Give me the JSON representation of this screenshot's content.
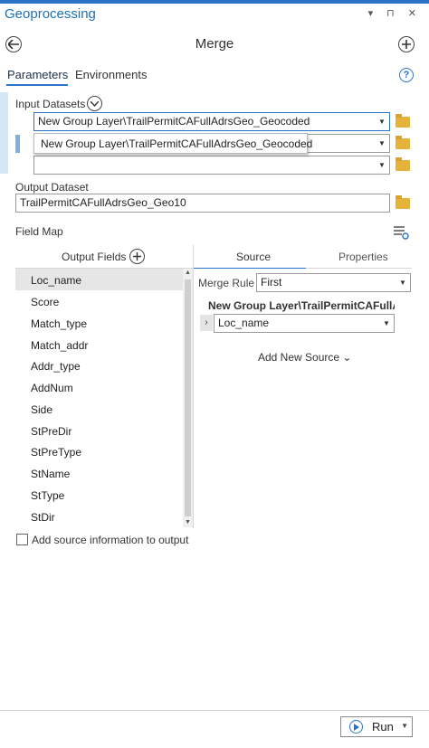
{
  "window": {
    "title": "Geoprocessing",
    "controls": "▾ ⊓ ✕"
  },
  "header": {
    "tool_name": "Merge",
    "back_icon": "circle-arrow-left-icon",
    "add_icon": "circle-plus-icon"
  },
  "tabs": [
    {
      "label": "Parameters",
      "active": true
    },
    {
      "label": "Environments",
      "active": false
    }
  ],
  "help": "?",
  "input_datasets": {
    "label": "Input Datasets",
    "rows": [
      "New Group Layer\\TrailPermitCAFullAdrsGeo_Geocoded",
      "",
      ""
    ],
    "popup_text": "New Group Layer\\TrailPermitCAFullAdrsGeo_Geocoded"
  },
  "output_dataset": {
    "label": "Output Dataset",
    "value": "TrailPermitCAFullAdrsGeo_Geo10"
  },
  "field_map": {
    "label": "Field Map",
    "output_fields_header": "Output Fields",
    "fields": [
      "Loc_name",
      "Score",
      "Match_type",
      "Match_addr",
      "Addr_type",
      "AddNum",
      "Side",
      "StPreDir",
      "StPreType",
      "StName",
      "StType",
      "StDir"
    ],
    "selected_field": "Loc_name",
    "right_tabs": [
      "Source",
      "Properties"
    ],
    "merge_rule_label": "Merge Rule",
    "merge_rule_value": "First",
    "source_layer": "New Group Layer\\TrailPermitCAFullA",
    "source_field": "Loc_name",
    "add_new_source": "Add New Source ⌄"
  },
  "add_source_info": "Add source information to output",
  "run_label": "Run",
  "colors": {
    "accent": "#2b73c8",
    "folder": "#e6b33a"
  }
}
